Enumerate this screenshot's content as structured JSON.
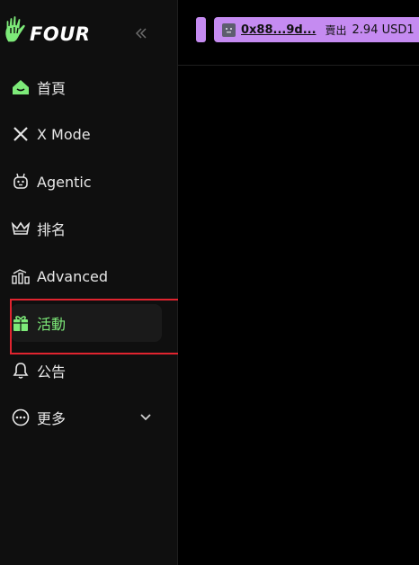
{
  "brand": {
    "name": "FOUR"
  },
  "sidebar": {
    "collapse_icon": "chevrons-left-icon",
    "items": [
      {
        "label": "首頁",
        "icon": "home-icon",
        "active": false
      },
      {
        "label": "X Mode",
        "icon": "x-icon",
        "active": false
      },
      {
        "label": "Agentic",
        "icon": "robot-icon",
        "active": false
      },
      {
        "label": "排名",
        "icon": "crown-icon",
        "active": false
      },
      {
        "label": "Advanced",
        "icon": "bar-chart-icon",
        "active": false
      },
      {
        "label": "活動",
        "icon": "gift-icon",
        "active": true
      },
      {
        "label": "公告",
        "icon": "bell-icon",
        "active": false
      },
      {
        "label": "更多",
        "icon": "more-icon",
        "active": false
      }
    ]
  },
  "ticker": {
    "address": "0x88...9d...",
    "action": "賣出",
    "amount": "2.94 USD1"
  },
  "colors": {
    "accent_green": "#7dea79",
    "ticker_purple": "#c58bf1",
    "highlight_red": "#e0242f"
  }
}
